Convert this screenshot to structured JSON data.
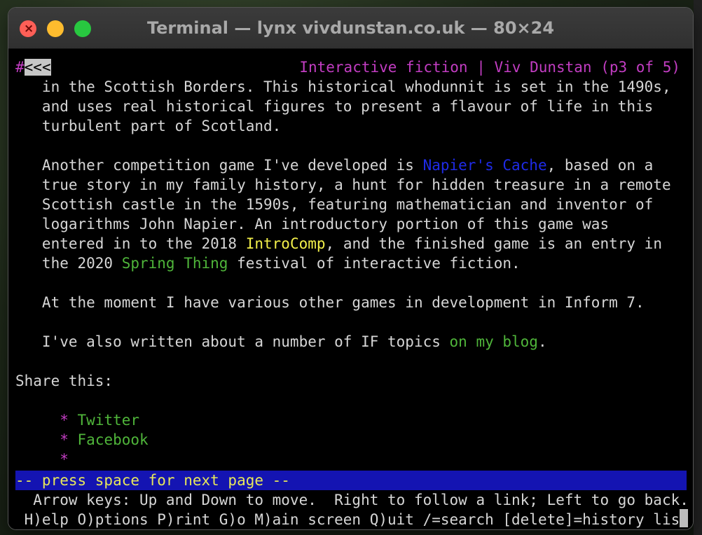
{
  "window": {
    "title": "Terminal — lynx vivdunstan.co.uk — 80×24"
  },
  "header": {
    "hash": "#",
    "back": "<<<",
    "page_title": "Interactive fiction | Viv Dunstan (p3 of 5)"
  },
  "lines": {
    "l1": "   in the Scottish Borders. This historical whodunnit is set in the 1490s,",
    "l2": "   and uses real historical figures to present a flavour of life in this",
    "l3": "   turbulent part of Scotland.",
    "l5_pre": "   Another competition game I've developed is ",
    "l5_link": "Napier's Cache",
    "l5_post": ", based on a",
    "l6": "   true story in my family history, a hunt for hidden treasure in a remote",
    "l7": "   Scottish castle in the 1590s, featuring mathematician and inventor of",
    "l8": "   logarithms John Napier. An introductory portion of this game was",
    "l9_pre": "   entered in to the 2018 ",
    "l9_link": "IntroComp",
    "l9_post": ", and the finished game is an entry in",
    "l10_pre": "   the 2020 ",
    "l10_link": "Spring Thing",
    "l10_post": " festival of interactive fiction.",
    "l12": "   At the moment I have various other games in development in Inform 7.",
    "l14_pre": "   I've also written about a number of IF topics ",
    "l14_link": "on my blog",
    "l14_post": ".",
    "l16": "Share this:",
    "bullet": "*",
    "share_twitter": "Twitter",
    "share_facebook": "Facebook"
  },
  "status": {
    "prompt": "-- press space for next page --"
  },
  "help": {
    "line1": "  Arrow keys: Up and Down to move.  Right to follow a link; Left to go back.",
    "line2": " H)elp O)ptions P)rint G)o M)ain screen Q)uit /=search [delete]=history list"
  },
  "colors": {
    "link_blue": "#1f2be8",
    "link_yellow": "#f3f04a",
    "link_green": "#4fb53a",
    "magenta": "#c23dc2",
    "status_bg": "#1414b2"
  }
}
